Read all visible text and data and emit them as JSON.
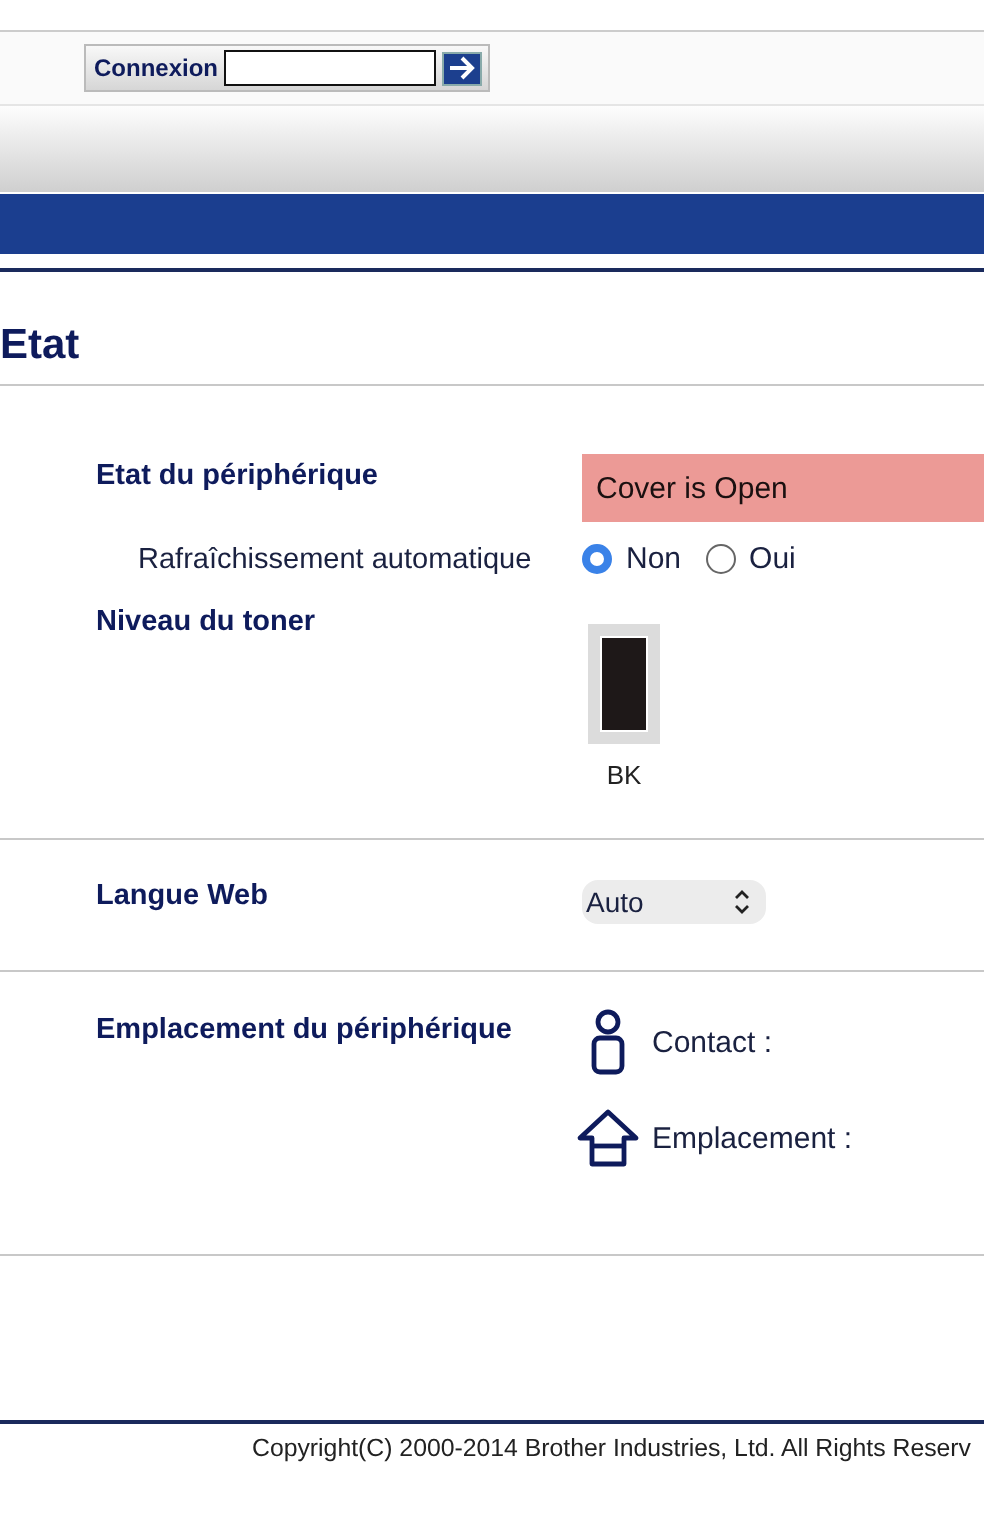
{
  "login": {
    "label": "Connexion"
  },
  "page_title": "Etat",
  "device_status": {
    "label": "Etat du périphérique",
    "value": "Cover is Open"
  },
  "auto_refresh": {
    "label": "Rafraîchissement automatique",
    "options": [
      {
        "label": "Non",
        "selected": true
      },
      {
        "label": "Oui",
        "selected": false
      }
    ]
  },
  "toner": {
    "label": "Niveau du toner",
    "cartridges": [
      {
        "name": "BK"
      }
    ]
  },
  "web_language": {
    "label": "Langue Web",
    "value": "Auto"
  },
  "device_location": {
    "label": "Emplacement du périphérique",
    "items": [
      {
        "kind": "contact",
        "label": "Contact :"
      },
      {
        "kind": "location",
        "label": "Emplacement :"
      }
    ]
  },
  "footer": "Copyright(C) 2000-2014 Brother Industries, Ltd. All Rights Reserv"
}
